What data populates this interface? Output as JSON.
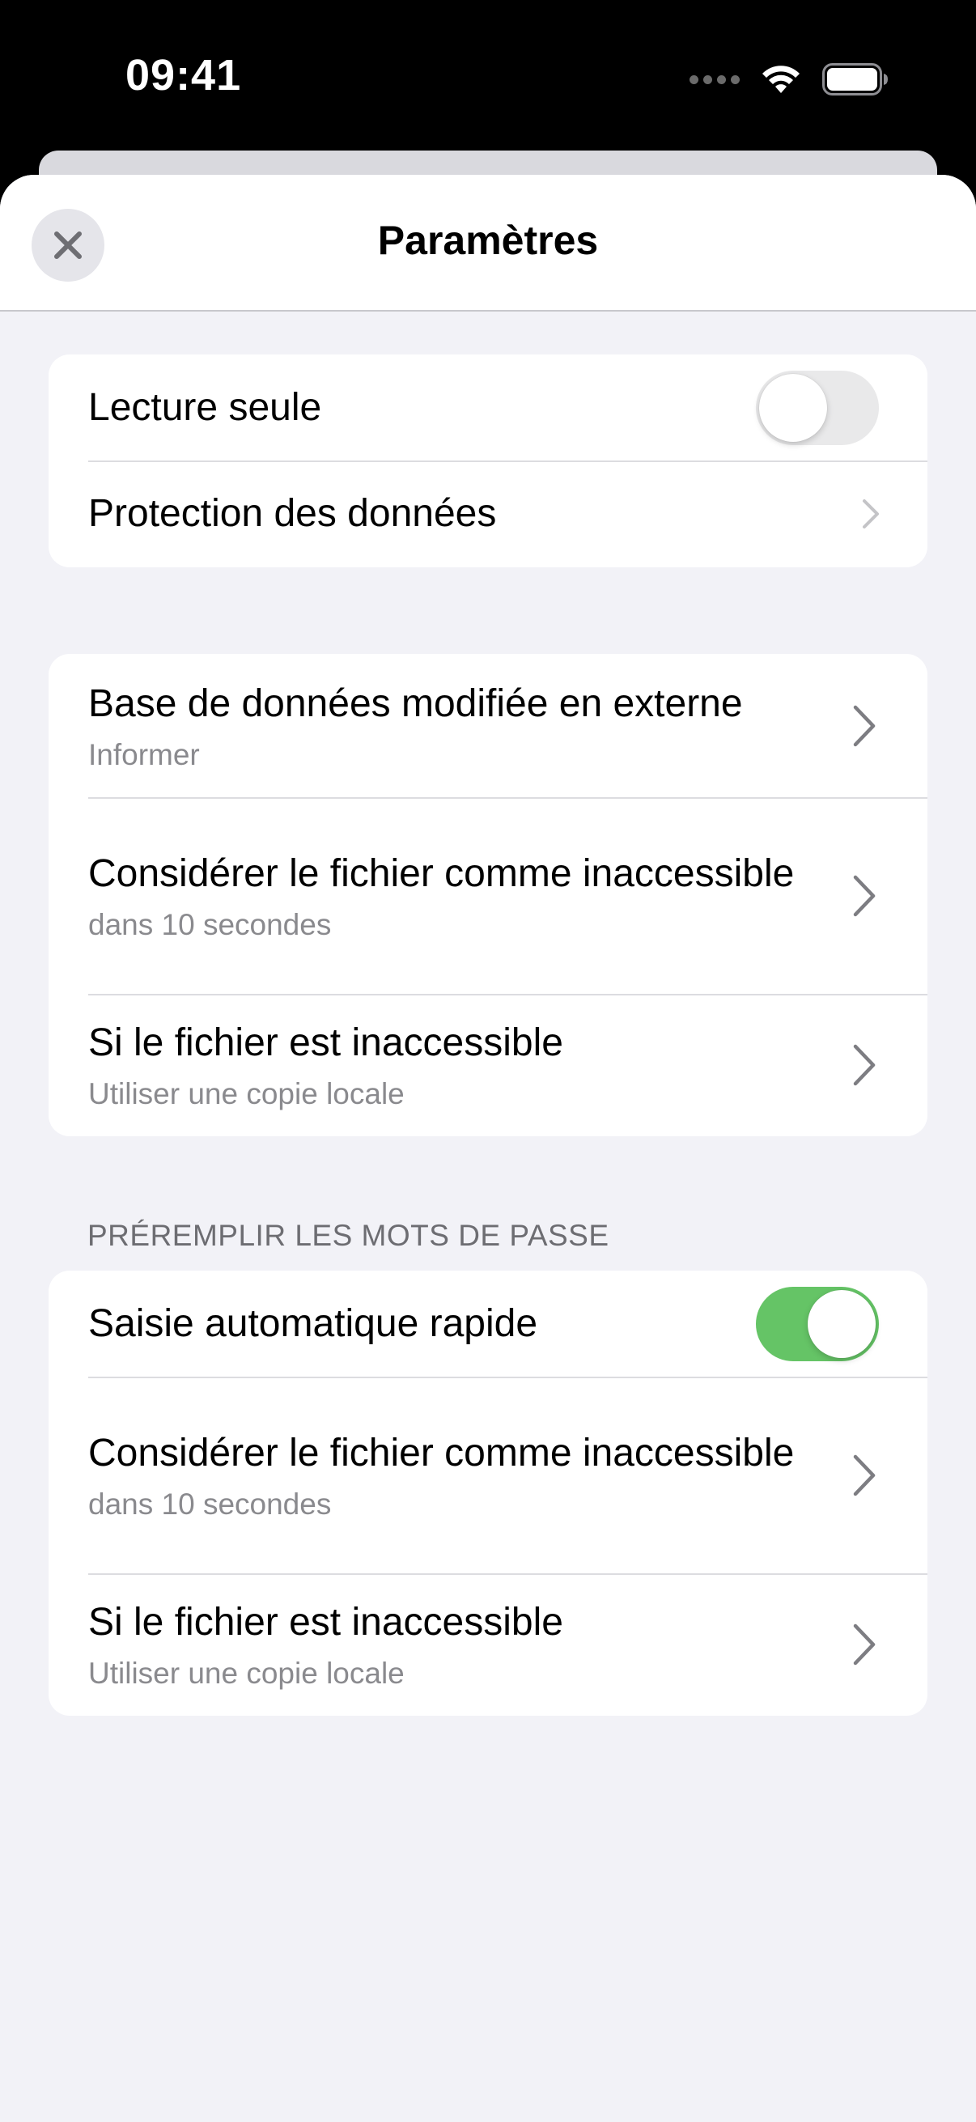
{
  "status_bar": {
    "time": "09:41",
    "icons": [
      "cellular-signal-icon",
      "wifi-icon",
      "battery-icon"
    ]
  },
  "nav": {
    "title": "Paramètres",
    "close_icon": "close-icon"
  },
  "group1": {
    "read_only": {
      "label": "Lecture seule",
      "toggle_on": false
    },
    "data_protection": {
      "label": "Protection des données"
    }
  },
  "group2": {
    "items": [
      {
        "title": "Base de données modifiée en externe",
        "subtitle": "Informer"
      },
      {
        "title": "Considérer le fichier comme inaccessible",
        "subtitle": "dans 10 secondes"
      },
      {
        "title": "Si le fichier est inaccessible",
        "subtitle": "Utiliser une copie locale"
      }
    ]
  },
  "group3": {
    "header": "PRÉREMPLIR LES MOTS DE PASSE",
    "quick_autofill": {
      "label": "Saisie automatique rapide",
      "toggle_on": true
    },
    "items": [
      {
        "title": "Considérer le fichier comme inaccessible",
        "subtitle": "dans 10 secondes"
      },
      {
        "title": "Si le fichier est inaccessible",
        "subtitle": "Utiliser une copie locale"
      }
    ]
  },
  "colors": {
    "toggle_on": "#65c466",
    "toggle_off": "#e9e9ea",
    "background": "#f2f2f7",
    "secondary_text": "#8a8a8e"
  }
}
